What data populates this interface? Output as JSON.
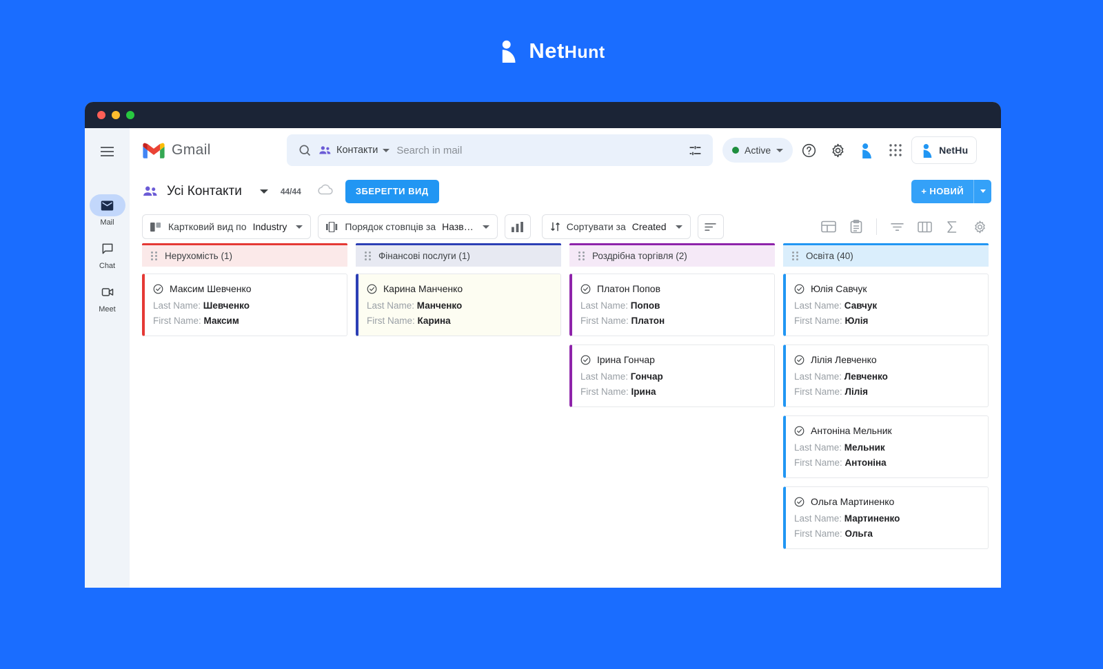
{
  "brand": {
    "name_part1": "Net",
    "name_part2": "Hunt",
    "logo_icon": "nethunt-logo-icon"
  },
  "titlebar": {
    "close": "close-dot",
    "minimize": "minimize-dot",
    "maximize": "maximize-dot"
  },
  "rail": {
    "menu_icon": "hamburger-menu-icon",
    "items": [
      {
        "label": "Mail",
        "icon": "mail-icon",
        "active": true
      },
      {
        "label": "Chat",
        "icon": "chat-icon",
        "active": false
      },
      {
        "label": "Meet",
        "icon": "meet-camera-icon",
        "active": false
      }
    ]
  },
  "header": {
    "gmail_label": "Gmail",
    "gmail_icon": "gmail-logo-icon",
    "search": {
      "icon": "search-icon",
      "chip_label": "Контакти",
      "chip_icon": "contacts-people-icon",
      "placeholder": "Search in mail",
      "value": "",
      "tune_icon": "search-options-icon"
    },
    "status": {
      "label": "Active",
      "dot_color": "#1e8e3e"
    },
    "help_icon": "help-question-icon",
    "settings_icon": "gear-icon",
    "nethunt_icon": "nethunt-icon",
    "apps_icon": "apps-grid-icon",
    "nethunt_button_label": "NetHu"
  },
  "toolbar": {
    "view_icon": "contacts-people-icon",
    "view_name": "Усі Контакти",
    "record_count": "44/44",
    "cloud_icon": "cloud-icon",
    "save_view_label": "ЗБЕРЕГТИ ВИД",
    "new_label": "+ НОВИЙ"
  },
  "filters": {
    "card_view": {
      "icon": "card-view-icon",
      "label_prefix": "Картковий вид по",
      "label_value": "Industry"
    },
    "column_order": {
      "icon": "column-order-icon",
      "label_prefix": "Порядок стовпців за",
      "label_value": "Назв…"
    },
    "chart_icon": "bar-chart-icon",
    "sort": {
      "icon": "sort-arrows-icon",
      "label_prefix": "Сортувати за",
      "label_value": "Created"
    },
    "sort_direction_icon": "sort-lines-icon",
    "right_icons": [
      "split-layout-icon",
      "clipboard-icon",
      "filter-icon",
      "columns-icon",
      "sigma-icon",
      "gear-icon"
    ]
  },
  "board": {
    "columns": [
      {
        "title": "Нерухомість (1)",
        "accent": "#e53935",
        "head_bg": "#fbe9e9",
        "cards": [
          {
            "name": "Максим Шевченко",
            "last_label": "Last Name:",
            "last_value": "Шевченко",
            "first_label": "First Name:",
            "first_value": "Максим",
            "highlight": false
          }
        ]
      },
      {
        "title": "Фінансові послуги (1)",
        "accent": "#2c3fb5",
        "head_bg": "#e7e9f2",
        "cards": [
          {
            "name": "Карина Манченко",
            "last_label": "Last Name:",
            "last_value": "Манченко",
            "first_label": "First Name:",
            "first_value": "Карина",
            "highlight": true
          }
        ]
      },
      {
        "title": "Роздрібна торгівля (2)",
        "accent": "#8e24aa",
        "head_bg": "#f5e9f7",
        "cards": [
          {
            "name": "Платон Попов",
            "last_label": "Last Name:",
            "last_value": "Попов",
            "first_label": "First Name:",
            "first_value": "Платон",
            "highlight": false
          },
          {
            "name": "Ірина Гончар",
            "last_label": "Last Name:",
            "last_value": "Гончар",
            "first_label": "First Name:",
            "first_value": "Ірина",
            "highlight": false
          }
        ]
      },
      {
        "title": "Освіта  (40)",
        "accent": "#2196f3",
        "head_bg": "#daeefc",
        "cards": [
          {
            "name": "Юлія Савчук",
            "last_label": "Last Name:",
            "last_value": "Савчук",
            "first_label": "First Name:",
            "first_value": "Юлія",
            "highlight": false
          },
          {
            "name": "Лілія Левченко",
            "last_label": "Last Name:",
            "last_value": "Левченко",
            "first_label": "First Name:",
            "first_value": "Лілія",
            "highlight": false
          },
          {
            "name": "Антоніна Мельник",
            "last_label": "Last Name:",
            "last_value": "Мельник",
            "first_label": "First Name:",
            "first_value": "Антоніна",
            "highlight": false
          },
          {
            "name": "Ольга Мартиненко",
            "last_label": "Last Name:",
            "last_value": "Мартиненко",
            "first_label": "First Name:",
            "first_value": "Ольга",
            "highlight": false
          }
        ]
      }
    ]
  }
}
